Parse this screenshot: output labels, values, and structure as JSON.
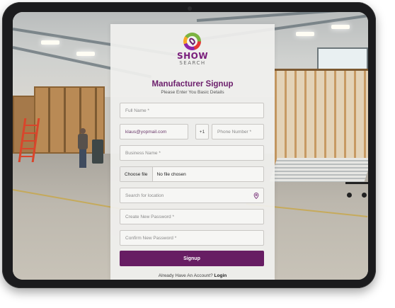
{
  "logo": {
    "word_main": "SHOW",
    "word_sub": "SEARCH"
  },
  "form": {
    "title": "Manufacturer Signup",
    "subtitle": "Please Enter You Basic Details",
    "full_name_placeholder": "Full Name *",
    "email_value": "klaus@yopmail.com",
    "country_code": "+1",
    "phone_placeholder": "Phone Number *",
    "business_name_placeholder": "Business Name *",
    "file_button_label": "Choose file",
    "file_status": "No file chosen",
    "location_placeholder": "Search for location",
    "password_placeholder": "Create New Password *",
    "confirm_password_placeholder": "Confirm New Password *",
    "submit_label": "Signup",
    "login_prompt": "Already Have An Account?",
    "login_link": "Login"
  },
  "icons": {
    "location": "map-pin-icon"
  },
  "colors": {
    "brand_purple": "#671d63",
    "title_purple": "#6b1d6b"
  }
}
